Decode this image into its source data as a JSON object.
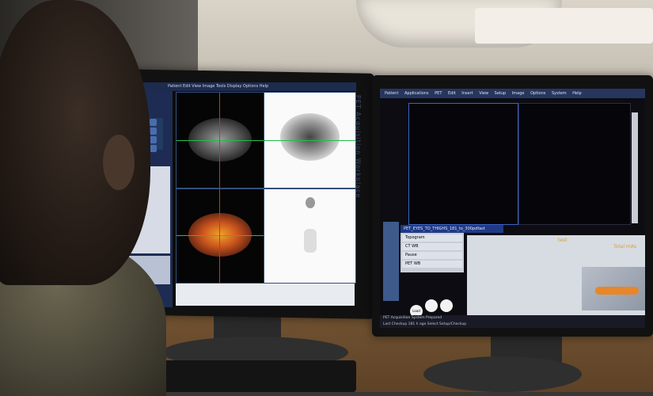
{
  "left_screen": {
    "menu": "Patient  Edit  View  Image  Tools  Display  Options  Help",
    "vertical_label": "PET Acquisition Workplace"
  },
  "right_screen": {
    "menu": [
      "Patient",
      "Applications",
      "PET",
      "Edit",
      "Insert",
      "View",
      "Setup",
      "Image",
      "Options",
      "System",
      "Help"
    ],
    "protocol": "PET_EYES_TO_THIGHS_181_to_300pdfast",
    "steps": [
      "Topogram",
      "CT WB",
      "Pause",
      "PET WB"
    ],
    "test_label": "test",
    "total_label": "Total mAs",
    "buttons": [
      "Load",
      "",
      ""
    ],
    "status_lines": [
      "PET Acquisition System Prepared",
      "Last Checkup 181 h ago   Select Setup/Checkup"
    ]
  }
}
